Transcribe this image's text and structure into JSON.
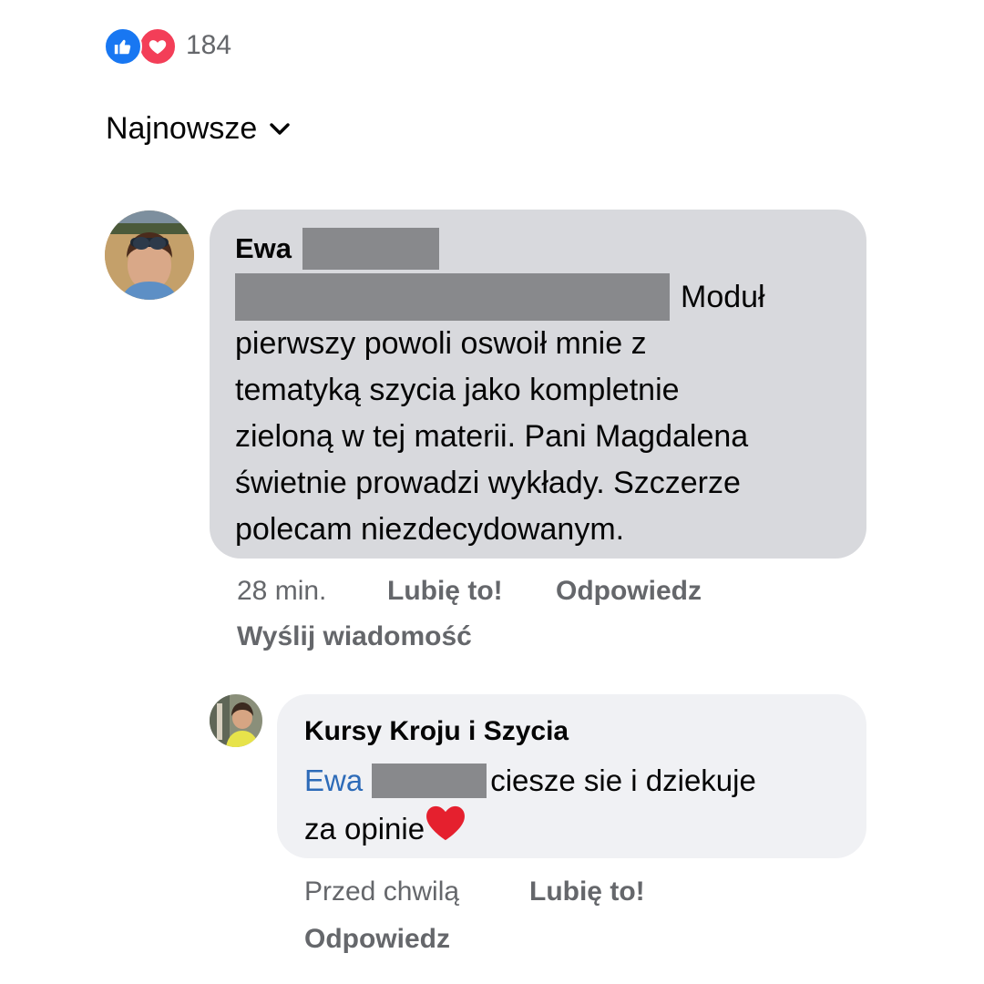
{
  "reactions": {
    "icons": [
      "like-icon",
      "love-icon"
    ],
    "count": "184",
    "colors": {
      "like": "#1877f2",
      "love": "#f33e58"
    }
  },
  "sort": {
    "label": "Najnowsze",
    "icon": "chevron-down-icon"
  },
  "comment": {
    "author": "Ewa",
    "lines": [
      "Moduł",
      "pierwszy powoli oswoił mnie z",
      "tematyką szycia jako kompletnie",
      "zieloną w tej materii. Pani Magdalena",
      "świetnie prowadzi wykłady. Szczerze",
      "polecam niezdecydowanym."
    ],
    "time": "28 min.",
    "like": "Lubię to!",
    "reply": "Odpowiedz",
    "send_message": "Wyślij wiadomość",
    "bubble_color": "#d8d9dd"
  },
  "reply": {
    "author": "Kursy Kroju i Szycia",
    "mention": "Ewa",
    "line1_rest": "ciesze sie i dziekuje",
    "line2": "za opinie",
    "emoji": "red-heart-icon",
    "time": "Przed chwilą",
    "like": "Lubię to!",
    "reply": "Odpowiedz",
    "bubble_color": "#f0f1f4",
    "mention_color": "#2d6bb8"
  }
}
